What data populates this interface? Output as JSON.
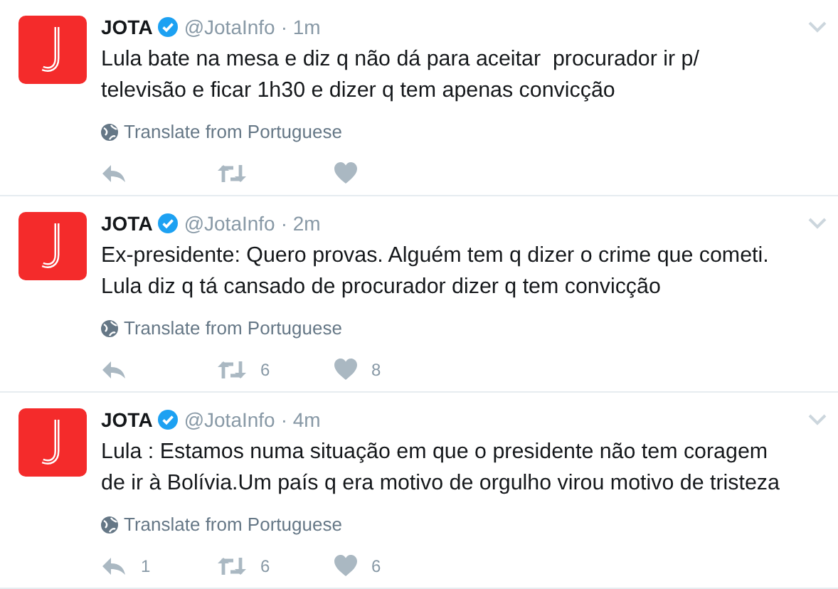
{
  "tweets": [
    {
      "name": "JOTA",
      "verified": true,
      "handle": "@JotaInfo",
      "time": "· 1m",
      "text": "Lula bate na mesa e diz q não dá para aceitar  procurador ir p/ televisão e ficar 1h30 e dizer q tem apenas convicção",
      "translate": "Translate from Portuguese"
    },
    {
      "name": "JOTA",
      "verified": true,
      "handle": "@JotaInfo",
      "time": "· 2m",
      "text": "Ex-presidente: Quero provas. Alguém tem q dizer o crime que cometi. Lula diz q tá cansado de procurador dizer q tem convicção",
      "translate": "Translate from Portuguese",
      "actions": {
        "retweet": "6",
        "like": "8"
      }
    },
    {
      "name": "JOTA",
      "verified": true,
      "handle": "@JotaInfo",
      "time": "· 4m",
      "text": "Lula : Estamos numa situação em que o presidente não tem coragem de ir à Bolívia.Um país q era motivo de orgulho virou motivo de tristeza",
      "translate": "Translate from Portuguese",
      "actions": {
        "reply": "1",
        "retweet": "6",
        "like": "6"
      }
    }
  ]
}
